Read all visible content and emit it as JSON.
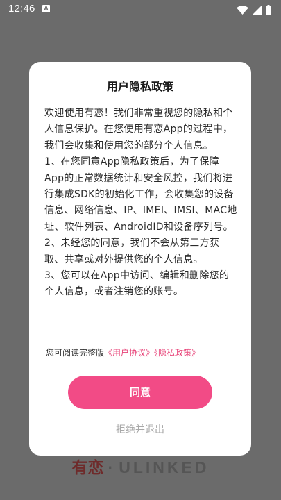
{
  "status_bar": {
    "time": "12:46",
    "notification_glyph": "A",
    "icons": [
      "wifi-icon",
      "cell-signal-icon",
      "battery-icon"
    ]
  },
  "background_logo": {
    "cn": "有恋",
    "separator": "·",
    "en": "ULINKED"
  },
  "dialog": {
    "title": "用户隐私政策",
    "paragraphs": [
      "欢迎使用有恋！我们非常重视您的隐私和个人信息保护。在您使用有恋App的过程中，我们会收集和使用您的部分个人信息。",
      "1、在您同意App隐私政策后，为了保障App的正常数据统计和安全风控，我们将进行集成SDK的初始化工作，会收集您的设备信息、网络信息、IP、IMEI、IMSI、MAC地址、软件列表、AndroidID和设备序列号。",
      "2、未经您的同意，我们不会从第三方获取、共享或对外提供您的个人信息。",
      "3、您可以在App中访问、编辑和删除您的个人信息，或者注销您的账号。"
    ],
    "links_prefix": "您可阅读完整版",
    "user_agreement_link": "《用户协议》",
    "privacy_policy_link": "《隐私政策》",
    "agree_label": "同意",
    "reject_label": "拒绝并退出"
  },
  "colors": {
    "accent": "#f24b86",
    "link": "#e8457a",
    "overlay": "#6b6b6b",
    "logo_cn": "#6e2b2b"
  }
}
